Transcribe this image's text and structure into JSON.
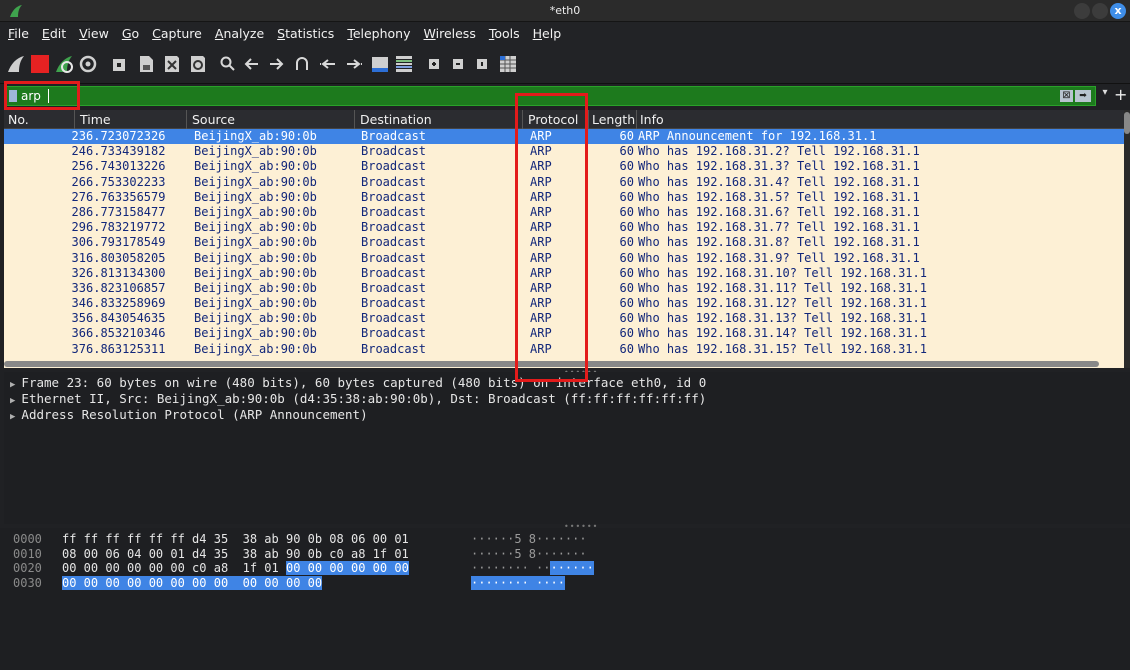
{
  "window": {
    "title": "*eth0",
    "close_glyph": "x",
    "app_icon": "wireshark-fin-icon"
  },
  "menu": [
    {
      "label": "File",
      "u": "F",
      "rest": "ile"
    },
    {
      "label": "Edit",
      "u": "E",
      "rest": "dit"
    },
    {
      "label": "View",
      "u": "V",
      "rest": "iew"
    },
    {
      "label": "Go",
      "u": "G",
      "rest": "o"
    },
    {
      "label": "Capture",
      "u": "C",
      "rest": "apture"
    },
    {
      "label": "Analyze",
      "u": "A",
      "rest": "nalyze"
    },
    {
      "label": "Statistics",
      "u": "S",
      "rest": "tatistics"
    },
    {
      "label": "Telephony",
      "u": "T",
      "pre": "",
      "rest": "elephony"
    },
    {
      "label": "Wireless",
      "u": "W",
      "rest": "ireless"
    },
    {
      "label": "Tools",
      "u": "T",
      "rest": "ools"
    },
    {
      "label": "Help",
      "u": "H",
      "rest": "elp"
    }
  ],
  "toolbar_icons": [
    "start-capture-icon",
    "stop-capture-icon",
    "restart-capture-icon",
    "capture-options-icon",
    "open-file-icon",
    "save-file-icon",
    "close-file-icon",
    "reload-file-icon",
    "find-packet-icon",
    "go-back-icon",
    "go-forward-icon",
    "go-to-packet-icon",
    "go-first-icon",
    "go-last-icon",
    "auto-scroll-icon",
    "colorize-icon",
    "zoom-in-icon",
    "zoom-out-icon",
    "normal-size-icon",
    "resize-columns-icon"
  ],
  "filter": {
    "value": "arp",
    "bookmark_icon": "filter-bookmark-icon"
  },
  "columns": [
    "No.",
    "Time",
    "Source",
    "Destination",
    "Protocol",
    "Length",
    "Info"
  ],
  "packets": [
    {
      "no": "23",
      "time": "6.723072326",
      "src": "BeijingX_ab:90:0b",
      "dst": "Broadcast",
      "proto": "ARP",
      "len": "60",
      "info": "ARP Announcement for 192.168.31.1",
      "selected": true
    },
    {
      "no": "24",
      "time": "6.733439182",
      "src": "BeijingX_ab:90:0b",
      "dst": "Broadcast",
      "proto": "ARP",
      "len": "60",
      "info": "Who has 192.168.31.2? Tell 192.168.31.1"
    },
    {
      "no": "25",
      "time": "6.743013226",
      "src": "BeijingX_ab:90:0b",
      "dst": "Broadcast",
      "proto": "ARP",
      "len": "60",
      "info": "Who has 192.168.31.3? Tell 192.168.31.1"
    },
    {
      "no": "26",
      "time": "6.753302233",
      "src": "BeijingX_ab:90:0b",
      "dst": "Broadcast",
      "proto": "ARP",
      "len": "60",
      "info": "Who has 192.168.31.4? Tell 192.168.31.1"
    },
    {
      "no": "27",
      "time": "6.763356579",
      "src": "BeijingX_ab:90:0b",
      "dst": "Broadcast",
      "proto": "ARP",
      "len": "60",
      "info": "Who has 192.168.31.5? Tell 192.168.31.1"
    },
    {
      "no": "28",
      "time": "6.773158477",
      "src": "BeijingX_ab:90:0b",
      "dst": "Broadcast",
      "proto": "ARP",
      "len": "60",
      "info": "Who has 192.168.31.6? Tell 192.168.31.1"
    },
    {
      "no": "29",
      "time": "6.783219772",
      "src": "BeijingX_ab:90:0b",
      "dst": "Broadcast",
      "proto": "ARP",
      "len": "60",
      "info": "Who has 192.168.31.7? Tell 192.168.31.1"
    },
    {
      "no": "30",
      "time": "6.793178549",
      "src": "BeijingX_ab:90:0b",
      "dst": "Broadcast",
      "proto": "ARP",
      "len": "60",
      "info": "Who has 192.168.31.8? Tell 192.168.31.1"
    },
    {
      "no": "31",
      "time": "6.803058205",
      "src": "BeijingX_ab:90:0b",
      "dst": "Broadcast",
      "proto": "ARP",
      "len": "60",
      "info": "Who has 192.168.31.9? Tell 192.168.31.1"
    },
    {
      "no": "32",
      "time": "6.813134300",
      "src": "BeijingX_ab:90:0b",
      "dst": "Broadcast",
      "proto": "ARP",
      "len": "60",
      "info": "Who has 192.168.31.10? Tell 192.168.31.1"
    },
    {
      "no": "33",
      "time": "6.823106857",
      "src": "BeijingX_ab:90:0b",
      "dst": "Broadcast",
      "proto": "ARP",
      "len": "60",
      "info": "Who has 192.168.31.11? Tell 192.168.31.1"
    },
    {
      "no": "34",
      "time": "6.833258969",
      "src": "BeijingX_ab:90:0b",
      "dst": "Broadcast",
      "proto": "ARP",
      "len": "60",
      "info": "Who has 192.168.31.12? Tell 192.168.31.1"
    },
    {
      "no": "35",
      "time": "6.843054635",
      "src": "BeijingX_ab:90:0b",
      "dst": "Broadcast",
      "proto": "ARP",
      "len": "60",
      "info": "Who has 192.168.31.13? Tell 192.168.31.1"
    },
    {
      "no": "36",
      "time": "6.853210346",
      "src": "BeijingX_ab:90:0b",
      "dst": "Broadcast",
      "proto": "ARP",
      "len": "60",
      "info": "Who has 192.168.31.14? Tell 192.168.31.1"
    },
    {
      "no": "37",
      "time": "6.863125311",
      "src": "BeijingX_ab:90:0b",
      "dst": "Broadcast",
      "proto": "ARP",
      "len": "60",
      "info": "Who has 192.168.31.15? Tell 192.168.31.1"
    }
  ],
  "details": [
    "Frame 23: 60 bytes on wire (480 bits), 60 bytes captured (480 bits) on interface eth0, id 0",
    "Ethernet II, Src: BeijingX_ab:90:0b (d4:35:38:ab:90:0b), Dst: Broadcast (ff:ff:ff:ff:ff:ff)",
    "Address Resolution Protocol (ARP Announcement)"
  ],
  "bytes": [
    {
      "offset": "0000",
      "hex": "ff ff ff ff ff ff d4 35  38 ab 90 0b 08 06 00 01",
      "hex_hl": "",
      "ascii": "······5 8·······",
      "ascii_hl": ""
    },
    {
      "offset": "0010",
      "hex": "08 00 06 04 00 01 d4 35  38 ab 90 0b c0 a8 1f 01",
      "hex_hl": "",
      "ascii": "······5 8·······",
      "ascii_hl": ""
    },
    {
      "offset": "0020",
      "hex": "00 00 00 00 00 00 c0 a8  1f 01 ",
      "hex_hl": "00 00 00 00 00 00",
      "ascii": "········ ··",
      "ascii_hl": "······"
    },
    {
      "offset": "0030",
      "hex": "",
      "hex_hl": "00 00 00 00 00 00 00 00  00 00 00 00",
      "ascii": "",
      "ascii_hl": "········ ····"
    }
  ]
}
